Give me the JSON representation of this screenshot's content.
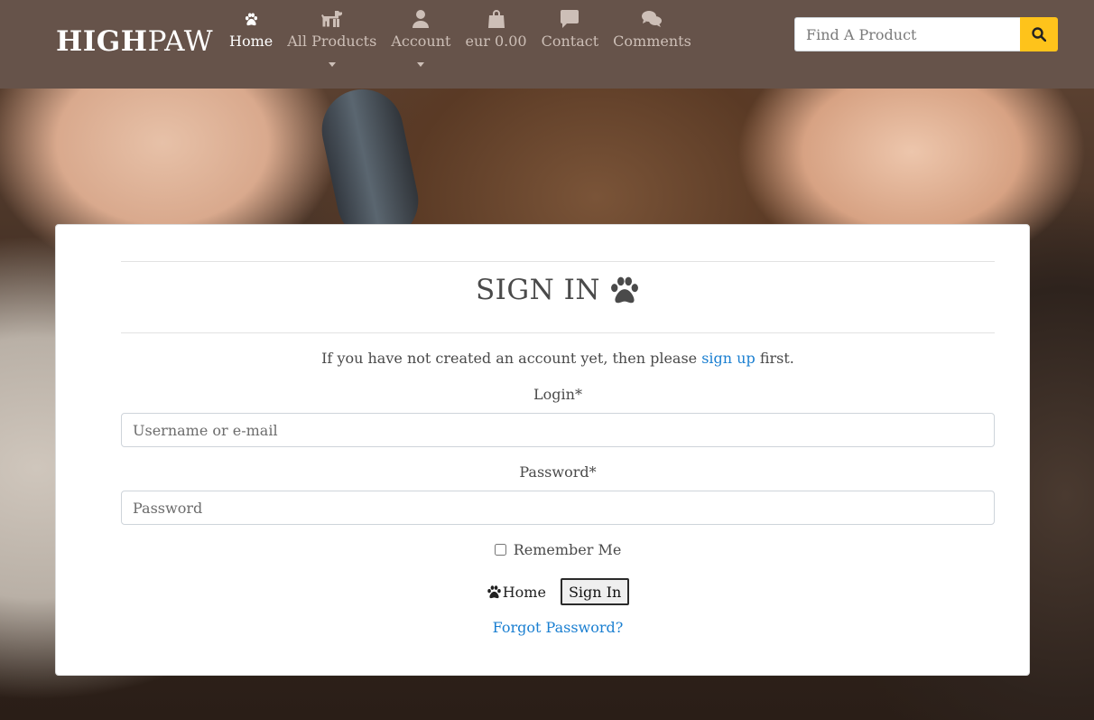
{
  "brand": {
    "bold": "HIGH",
    "light": "PAW"
  },
  "nav": {
    "home": "Home",
    "all_products": "All Products",
    "account": "Account",
    "bag": "eur 0.00",
    "contact": "Contact",
    "comments": "Comments"
  },
  "search": {
    "placeholder": "Find A Product"
  },
  "signin": {
    "title": "SIGN IN",
    "intro_before": "If you have not created an account yet, then please ",
    "intro_link": "sign up",
    "intro_after": " first.",
    "login_label": "Login*",
    "login_placeholder": "Username or e-mail",
    "password_label": "Password*",
    "password_placeholder": "Password",
    "remember": "Remember Me",
    "home_button": "Home",
    "signin_button": "Sign In",
    "forgot": "Forgot Password?"
  },
  "colors": {
    "navbar": "#66534a",
    "search_button": "#fec31b",
    "link": "#1a7fd1"
  },
  "icons": [
    "paw-icon",
    "dog-icon",
    "user-icon",
    "shopping-bag-icon",
    "message-icon",
    "comments-icon",
    "search-icon"
  ]
}
